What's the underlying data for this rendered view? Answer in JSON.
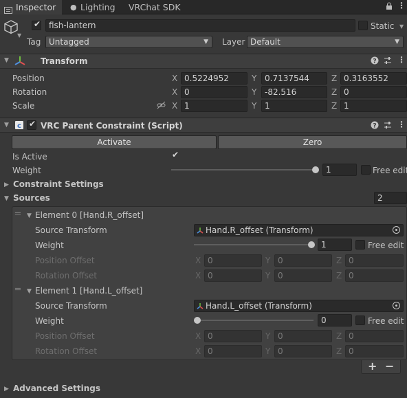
{
  "tabs": {
    "inspector": "Inspector",
    "lighting": "Lighting",
    "vrchat_sdk": "VRChat SDK"
  },
  "object": {
    "active": true,
    "name": "fish-lantern",
    "static_label": "Static",
    "tag_label": "Tag",
    "tag_value": "Untagged",
    "layer_label": "Layer",
    "layer_value": "Default"
  },
  "transform": {
    "title": "Transform",
    "position_label": "Position",
    "rotation_label": "Rotation",
    "scale_label": "Scale",
    "axis_x": "X",
    "axis_y": "Y",
    "axis_z": "Z",
    "position": {
      "x": "0.5224952",
      "y": "0.7137544",
      "z": "0.3163552"
    },
    "rotation": {
      "x": "0",
      "y": "-82.516",
      "z": "0"
    },
    "scale": {
      "x": "1",
      "y": "1",
      "z": "1"
    }
  },
  "constraint": {
    "title": "VRC Parent Constraint (Script)",
    "activate_button": "Activate",
    "zero_button": "Zero",
    "is_active_label": "Is Active",
    "weight_label": "Weight",
    "weight_value": "1",
    "free_edit_label": "Free edit",
    "constraint_settings": "Constraint Settings",
    "sources_label": "Sources",
    "sources_count": "2",
    "advanced_settings": "Advanced Settings",
    "add_button": "+",
    "remove_button": "−",
    "elements": [
      {
        "title": "Element 0 [Hand.R_offset]",
        "source_label": "Source Transform",
        "source_value": "Hand.R_offset (Transform)",
        "weight_label": "Weight",
        "weight_value": "1",
        "weight_fraction": 1,
        "free_edit_label": "Free edit",
        "position_offset_label": "Position Offset",
        "rotation_offset_label": "Rotation Offset",
        "position_offset": {
          "x": "0",
          "y": "0",
          "z": "0"
        },
        "rotation_offset": {
          "x": "0",
          "y": "0",
          "z": "0"
        }
      },
      {
        "title": "Element 1 [Hand.L_offset]",
        "source_label": "Source Transform",
        "source_value": "Hand.L_offset (Transform)",
        "weight_label": "Weight",
        "weight_value": "0",
        "weight_fraction": 0,
        "free_edit_label": "Free edit",
        "position_offset_label": "Position Offset",
        "rotation_offset_label": "Rotation Offset",
        "position_offset": {
          "x": "0",
          "y": "0",
          "z": "0"
        },
        "rotation_offset": {
          "x": "0",
          "y": "0",
          "z": "0"
        }
      }
    ]
  },
  "colors": {
    "background": "#383838",
    "tabbar": "#282828",
    "field": "#2a2a2a",
    "button": "#585858",
    "transform_icon_red": "#e05050",
    "transform_icon_green": "#70c040",
    "transform_icon_blue": "#4f8fe0"
  }
}
